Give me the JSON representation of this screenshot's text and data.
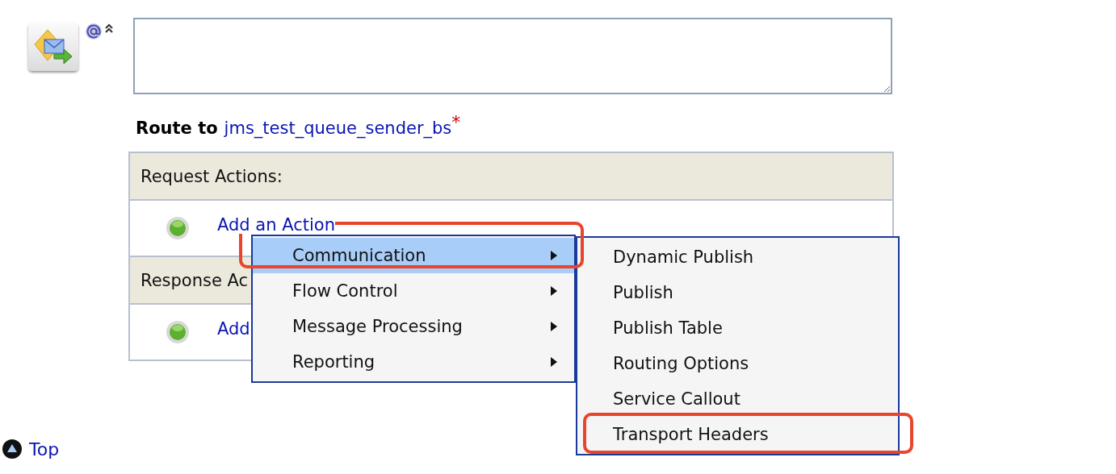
{
  "route": {
    "label": "Route to",
    "target": "jms_test_queue_sender_bs",
    "required_mark": "*"
  },
  "sections": [
    {
      "title": "Request Actions:",
      "link": "Add an Action"
    },
    {
      "title": "Response Ac",
      "link": "Add"
    }
  ],
  "menu": {
    "items": [
      {
        "label": "Communication",
        "selected": true,
        "has_submenu": true,
        "callout": true
      },
      {
        "label": "Flow Control",
        "selected": false,
        "has_submenu": true,
        "callout": false
      },
      {
        "label": "Message Processing",
        "selected": false,
        "has_submenu": true,
        "callout": false
      },
      {
        "label": "Reporting",
        "selected": false,
        "has_submenu": true,
        "callout": false
      }
    ]
  },
  "submenu": {
    "items": [
      {
        "label": "Dynamic Publish",
        "selected": false,
        "callout": false
      },
      {
        "label": "Publish",
        "selected": false,
        "callout": false
      },
      {
        "label": "Publish Table",
        "selected": false,
        "callout": false
      },
      {
        "label": "Routing Options",
        "selected": false,
        "callout": false
      },
      {
        "label": "Service Callout",
        "selected": false,
        "callout": false
      },
      {
        "label": "Transport Headers",
        "selected": false,
        "callout": true
      }
    ]
  },
  "footer": {
    "link": "Top"
  }
}
